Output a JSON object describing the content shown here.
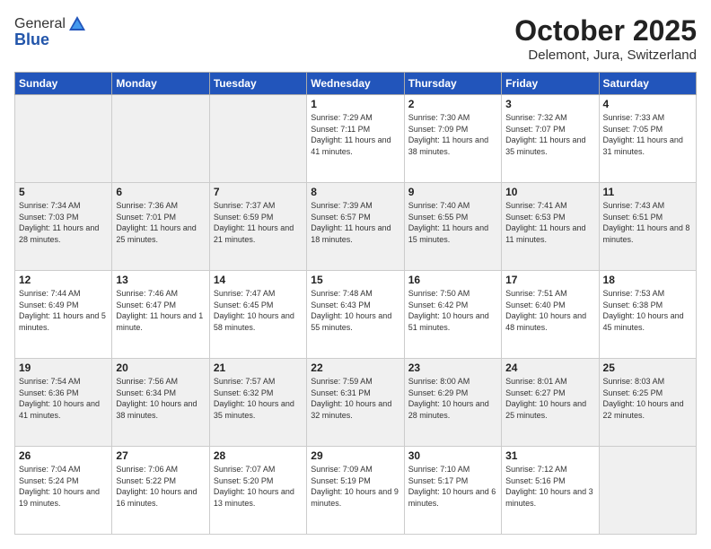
{
  "logo": {
    "line1": "General",
    "line2": "Blue"
  },
  "header": {
    "month": "October 2025",
    "location": "Delemont, Jura, Switzerland"
  },
  "weekdays": [
    "Sunday",
    "Monday",
    "Tuesday",
    "Wednesday",
    "Thursday",
    "Friday",
    "Saturday"
  ],
  "weeks": [
    [
      {
        "day": "",
        "empty": true
      },
      {
        "day": "",
        "empty": true
      },
      {
        "day": "",
        "empty": true
      },
      {
        "day": "1",
        "sunrise": "Sunrise: 7:29 AM",
        "sunset": "Sunset: 7:11 PM",
        "daylight": "Daylight: 11 hours and 41 minutes."
      },
      {
        "day": "2",
        "sunrise": "Sunrise: 7:30 AM",
        "sunset": "Sunset: 7:09 PM",
        "daylight": "Daylight: 11 hours and 38 minutes."
      },
      {
        "day": "3",
        "sunrise": "Sunrise: 7:32 AM",
        "sunset": "Sunset: 7:07 PM",
        "daylight": "Daylight: 11 hours and 35 minutes."
      },
      {
        "day": "4",
        "sunrise": "Sunrise: 7:33 AM",
        "sunset": "Sunset: 7:05 PM",
        "daylight": "Daylight: 11 hours and 31 minutes."
      }
    ],
    [
      {
        "day": "5",
        "sunrise": "Sunrise: 7:34 AM",
        "sunset": "Sunset: 7:03 PM",
        "daylight": "Daylight: 11 hours and 28 minutes."
      },
      {
        "day": "6",
        "sunrise": "Sunrise: 7:36 AM",
        "sunset": "Sunset: 7:01 PM",
        "daylight": "Daylight: 11 hours and 25 minutes."
      },
      {
        "day": "7",
        "sunrise": "Sunrise: 7:37 AM",
        "sunset": "Sunset: 6:59 PM",
        "daylight": "Daylight: 11 hours and 21 minutes."
      },
      {
        "day": "8",
        "sunrise": "Sunrise: 7:39 AM",
        "sunset": "Sunset: 6:57 PM",
        "daylight": "Daylight: 11 hours and 18 minutes."
      },
      {
        "day": "9",
        "sunrise": "Sunrise: 7:40 AM",
        "sunset": "Sunset: 6:55 PM",
        "daylight": "Daylight: 11 hours and 15 minutes."
      },
      {
        "day": "10",
        "sunrise": "Sunrise: 7:41 AM",
        "sunset": "Sunset: 6:53 PM",
        "daylight": "Daylight: 11 hours and 11 minutes."
      },
      {
        "day": "11",
        "sunrise": "Sunrise: 7:43 AM",
        "sunset": "Sunset: 6:51 PM",
        "daylight": "Daylight: 11 hours and 8 minutes."
      }
    ],
    [
      {
        "day": "12",
        "sunrise": "Sunrise: 7:44 AM",
        "sunset": "Sunset: 6:49 PM",
        "daylight": "Daylight: 11 hours and 5 minutes."
      },
      {
        "day": "13",
        "sunrise": "Sunrise: 7:46 AM",
        "sunset": "Sunset: 6:47 PM",
        "daylight": "Daylight: 11 hours and 1 minute."
      },
      {
        "day": "14",
        "sunrise": "Sunrise: 7:47 AM",
        "sunset": "Sunset: 6:45 PM",
        "daylight": "Daylight: 10 hours and 58 minutes."
      },
      {
        "day": "15",
        "sunrise": "Sunrise: 7:48 AM",
        "sunset": "Sunset: 6:43 PM",
        "daylight": "Daylight: 10 hours and 55 minutes."
      },
      {
        "day": "16",
        "sunrise": "Sunrise: 7:50 AM",
        "sunset": "Sunset: 6:42 PM",
        "daylight": "Daylight: 10 hours and 51 minutes."
      },
      {
        "day": "17",
        "sunrise": "Sunrise: 7:51 AM",
        "sunset": "Sunset: 6:40 PM",
        "daylight": "Daylight: 10 hours and 48 minutes."
      },
      {
        "day": "18",
        "sunrise": "Sunrise: 7:53 AM",
        "sunset": "Sunset: 6:38 PM",
        "daylight": "Daylight: 10 hours and 45 minutes."
      }
    ],
    [
      {
        "day": "19",
        "sunrise": "Sunrise: 7:54 AM",
        "sunset": "Sunset: 6:36 PM",
        "daylight": "Daylight: 10 hours and 41 minutes."
      },
      {
        "day": "20",
        "sunrise": "Sunrise: 7:56 AM",
        "sunset": "Sunset: 6:34 PM",
        "daylight": "Daylight: 10 hours and 38 minutes."
      },
      {
        "day": "21",
        "sunrise": "Sunrise: 7:57 AM",
        "sunset": "Sunset: 6:32 PM",
        "daylight": "Daylight: 10 hours and 35 minutes."
      },
      {
        "day": "22",
        "sunrise": "Sunrise: 7:59 AM",
        "sunset": "Sunset: 6:31 PM",
        "daylight": "Daylight: 10 hours and 32 minutes."
      },
      {
        "day": "23",
        "sunrise": "Sunrise: 8:00 AM",
        "sunset": "Sunset: 6:29 PM",
        "daylight": "Daylight: 10 hours and 28 minutes."
      },
      {
        "day": "24",
        "sunrise": "Sunrise: 8:01 AM",
        "sunset": "Sunset: 6:27 PM",
        "daylight": "Daylight: 10 hours and 25 minutes."
      },
      {
        "day": "25",
        "sunrise": "Sunrise: 8:03 AM",
        "sunset": "Sunset: 6:25 PM",
        "daylight": "Daylight: 10 hours and 22 minutes."
      }
    ],
    [
      {
        "day": "26",
        "sunrise": "Sunrise: 7:04 AM",
        "sunset": "Sunset: 5:24 PM",
        "daylight": "Daylight: 10 hours and 19 minutes."
      },
      {
        "day": "27",
        "sunrise": "Sunrise: 7:06 AM",
        "sunset": "Sunset: 5:22 PM",
        "daylight": "Daylight: 10 hours and 16 minutes."
      },
      {
        "day": "28",
        "sunrise": "Sunrise: 7:07 AM",
        "sunset": "Sunset: 5:20 PM",
        "daylight": "Daylight: 10 hours and 13 minutes."
      },
      {
        "day": "29",
        "sunrise": "Sunrise: 7:09 AM",
        "sunset": "Sunset: 5:19 PM",
        "daylight": "Daylight: 10 hours and 9 minutes."
      },
      {
        "day": "30",
        "sunrise": "Sunrise: 7:10 AM",
        "sunset": "Sunset: 5:17 PM",
        "daylight": "Daylight: 10 hours and 6 minutes."
      },
      {
        "day": "31",
        "sunrise": "Sunrise: 7:12 AM",
        "sunset": "Sunset: 5:16 PM",
        "daylight": "Daylight: 10 hours and 3 minutes."
      },
      {
        "day": "",
        "empty": true
      }
    ]
  ]
}
